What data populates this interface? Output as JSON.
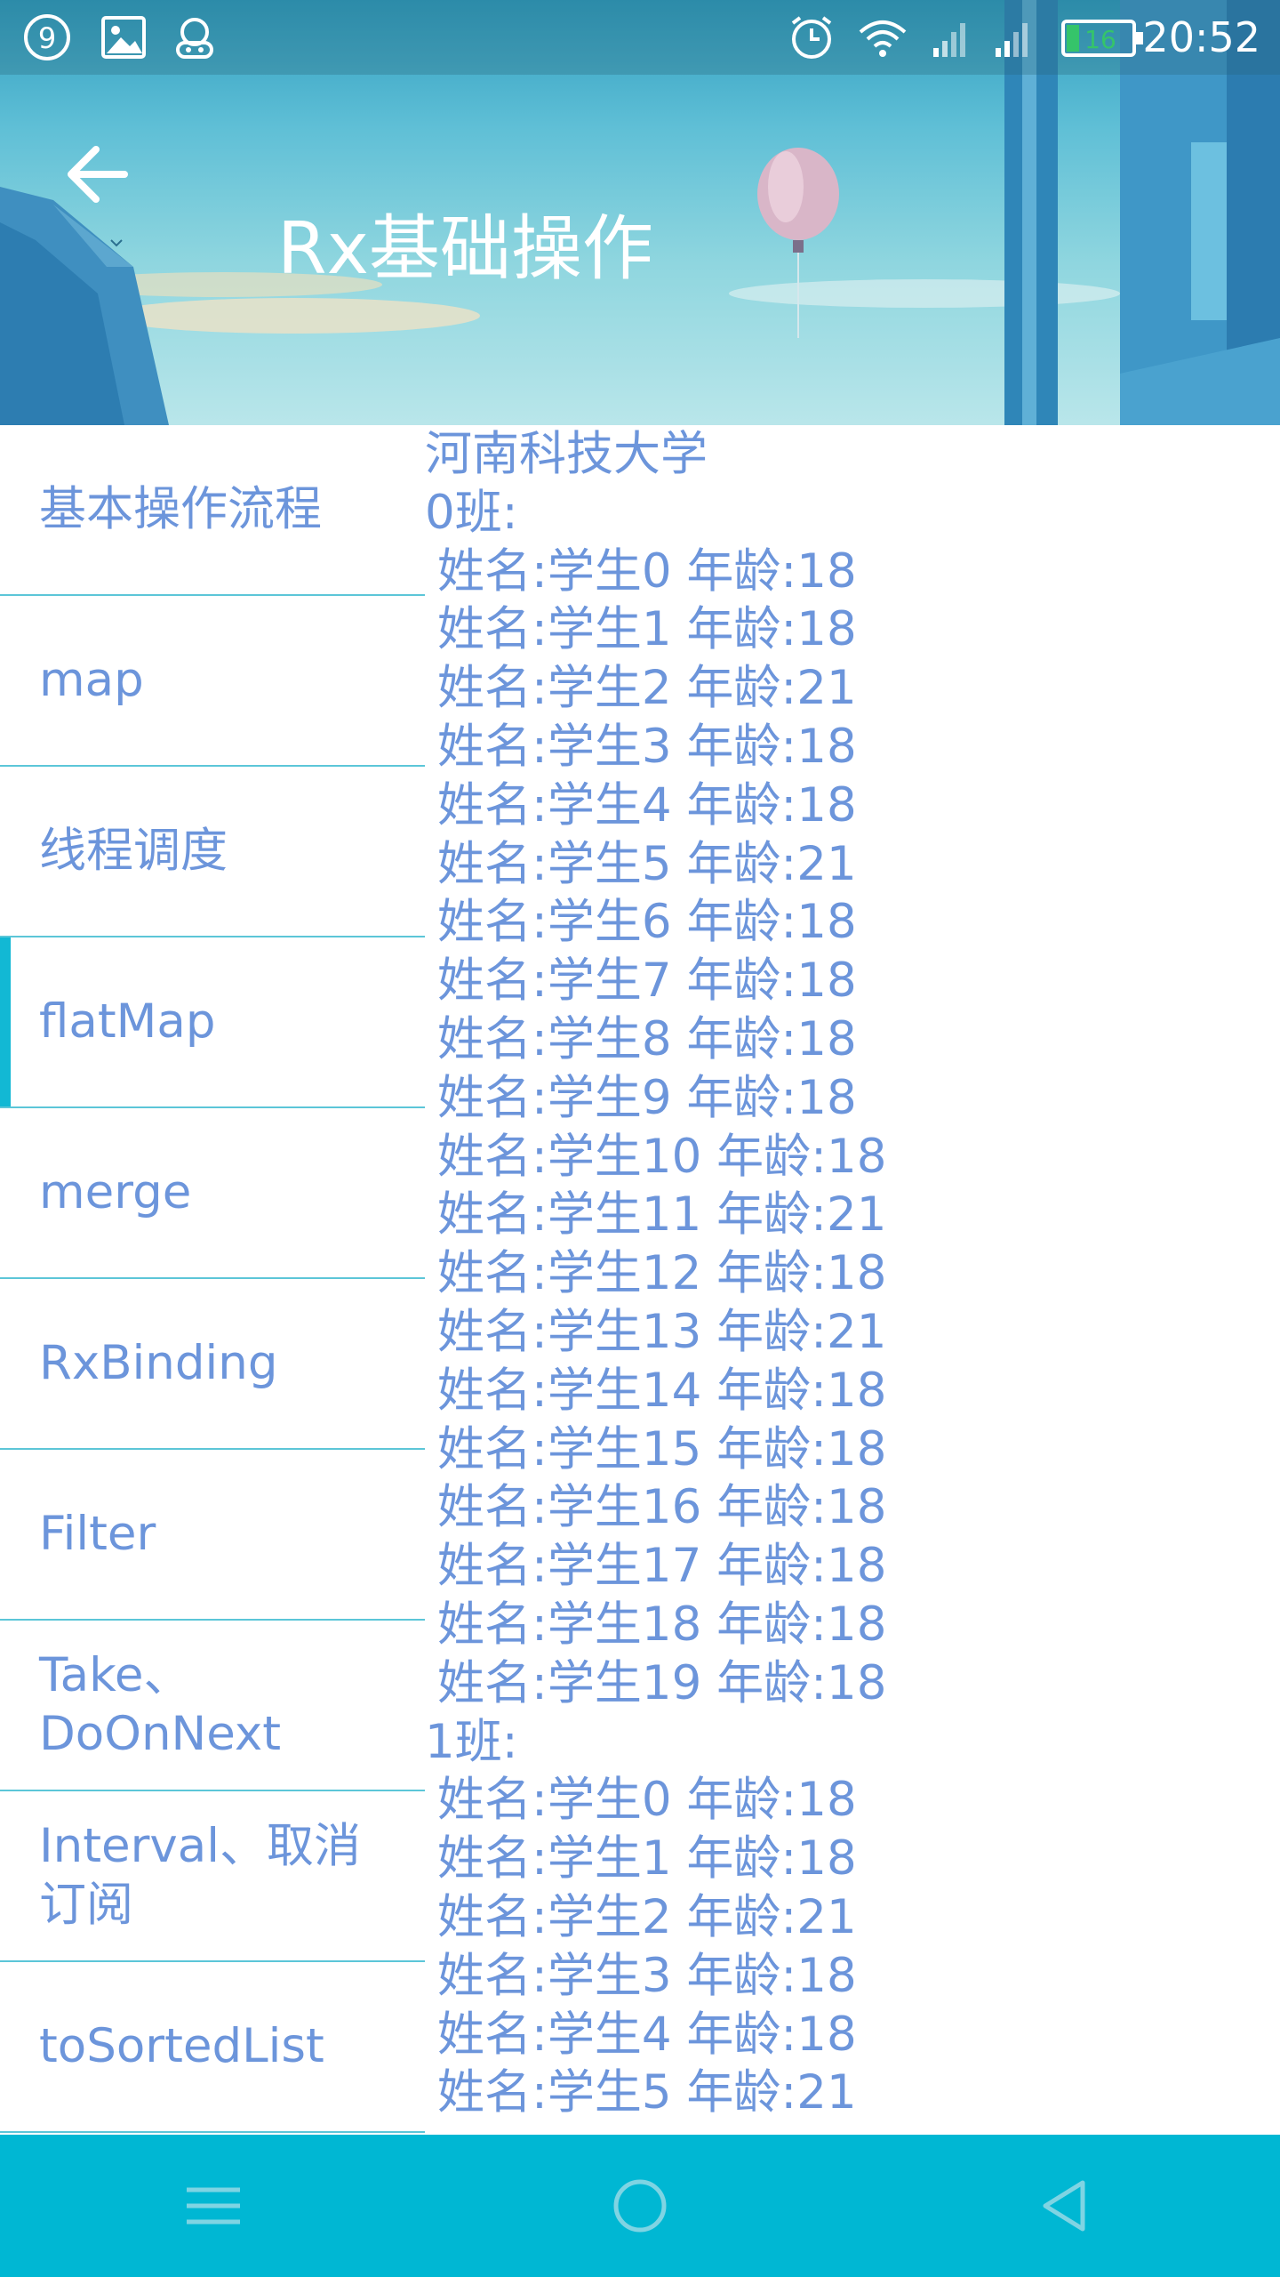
{
  "statusbar": {
    "time": "20:52",
    "battery_level": "16",
    "icons": [
      "notification-9-icon",
      "image-icon",
      "bot-icon",
      "alarm-icon",
      "wifi-icon",
      "signal-1-icon",
      "signal-2-icon",
      "battery-icon"
    ]
  },
  "header": {
    "title": "Rx基础操作",
    "back_icon": "arrow-left-icon"
  },
  "sidebar": {
    "active_index": 3,
    "accent_color": "#12b8d4",
    "items": [
      {
        "label": "基本操作流程"
      },
      {
        "label": "map"
      },
      {
        "label": "线程调度"
      },
      {
        "label": "flatMap"
      },
      {
        "label": "merge"
      },
      {
        "label": "RxBinding"
      },
      {
        "label": "Filter"
      },
      {
        "label": "Take、\nDoOnNext"
      },
      {
        "label": "Interval、取消\n订阅"
      },
      {
        "label": "toSortedList"
      }
    ]
  },
  "content": {
    "lines": [
      "河南科技大学",
      "0班:",
      "姓名:学生0 年龄:18",
      "姓名:学生1 年龄:18",
      "姓名:学生2 年龄:21",
      "姓名:学生3 年龄:18",
      "姓名:学生4 年龄:18",
      "姓名:学生5 年龄:21",
      "姓名:学生6 年龄:18",
      "姓名:学生7 年龄:18",
      "姓名:学生8 年龄:18",
      "姓名:学生9 年龄:18",
      "姓名:学生10 年龄:18",
      "姓名:学生11 年龄:21",
      "姓名:学生12 年龄:18",
      "姓名:学生13 年龄:21",
      "姓名:学生14 年龄:18",
      "姓名:学生15 年龄:18",
      "姓名:学生16 年龄:18",
      "姓名:学生17 年龄:18",
      "姓名:学生18 年龄:18",
      "姓名:学生19 年龄:18",
      "1班:",
      "姓名:学生0 年龄:18",
      "姓名:学生1 年龄:18",
      "姓名:学生2 年龄:21",
      "姓名:学生3 年龄:18",
      "姓名:学生4 年龄:18",
      "姓名:学生5 年龄:21"
    ]
  },
  "navbar": {
    "buttons": [
      "menu-icon",
      "home-icon",
      "back-triangle-icon"
    ]
  },
  "colors": {
    "text_blue": "#6c95db",
    "divider": "#5cc6d8",
    "navbar": "#00b7d3"
  }
}
